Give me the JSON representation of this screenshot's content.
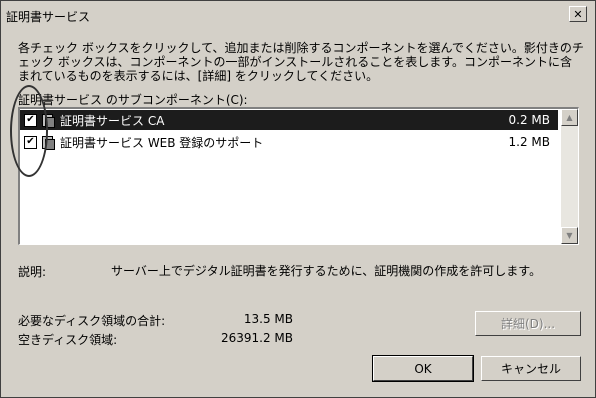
{
  "window": {
    "title": "証明書サービス"
  },
  "instructions": {
    "text": "各チェック ボックスをクリックして、追加または削除するコンポーネントを選んでください。影付きのチェック ボックスは、コンポーネントの一部がインストールされることを表します。コンポーネントに含まれているものを表示するには、[詳細] をクリックしてください。"
  },
  "components": {
    "label": "証明書サービス のサブコンポーネント(C):",
    "items": [
      {
        "name": "証明書サービス CA",
        "size": "0.2 MB",
        "checked": true,
        "selected": true
      },
      {
        "name": "証明書サービス WEB 登録のサポート",
        "size": "1.2 MB",
        "checked": true,
        "selected": false
      }
    ]
  },
  "description": {
    "label": "説明:",
    "text": "サーバー上でデジタル証明書を発行するために、証明機関の作成を許可します。"
  },
  "disk": {
    "required_label": "必要なディスク領域の合計:",
    "required_value": "13.5 MB",
    "free_label": "空きディスク領域:",
    "free_value": "26391.2 MB"
  },
  "buttons": {
    "details": "詳細(D)...",
    "ok": "OK",
    "cancel": "キャンセル"
  }
}
